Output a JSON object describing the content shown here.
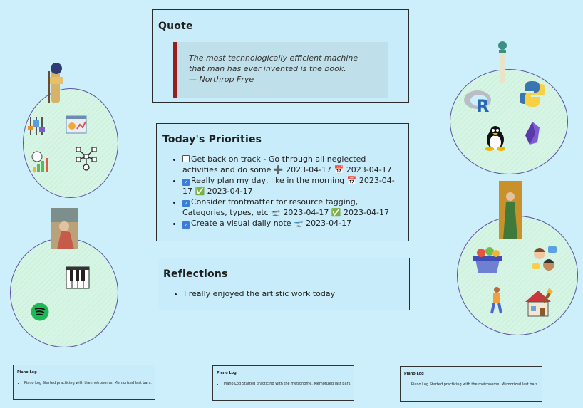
{
  "quote": {
    "title": "Quote",
    "lines": [
      "The most technologically efficient machine",
      "that man has ever invented is the book.",
      "— Northrop Frye"
    ]
  },
  "priorities": {
    "title": "Today's Priorities",
    "items": [
      {
        "checked": false,
        "text": "Get back on track - Go through all neglected activities and do some ➕ 2023-04-17 📅 2023-04-17"
      },
      {
        "checked": true,
        "text": "Really plan my day, like in the morning 📅 2023-04-17 ✅ 2023-04-17"
      },
      {
        "checked": true,
        "text": "Consider frontmatter for resource tagging, Categories, types, etc 🛫 2023-04-17 ✅ 2023-04-17"
      },
      {
        "checked": true,
        "text": "Create a visual daily note 🛫 2023-04-17"
      }
    ]
  },
  "reflections": {
    "title": "Reflections",
    "items": [
      "I really enjoyed the artistic work today"
    ]
  },
  "piano_logs": [
    {
      "title": "Piano Log",
      "item": "Piano Log Started practicing with the metronome. Memorized last bars."
    },
    {
      "title": "Piano Log",
      "item": "Piano Log Started practicing with the metronome. Memorized last bars."
    },
    {
      "title": "Piano Log",
      "item": "Piano Log Started practicing with the metronome. Memorized last bars."
    }
  ],
  "icons": {
    "r_letter": "R",
    "spotify_color": "#1db954",
    "quote_bar_color": "#9b1c1c",
    "circle_stroke": "#5b4fa6"
  }
}
